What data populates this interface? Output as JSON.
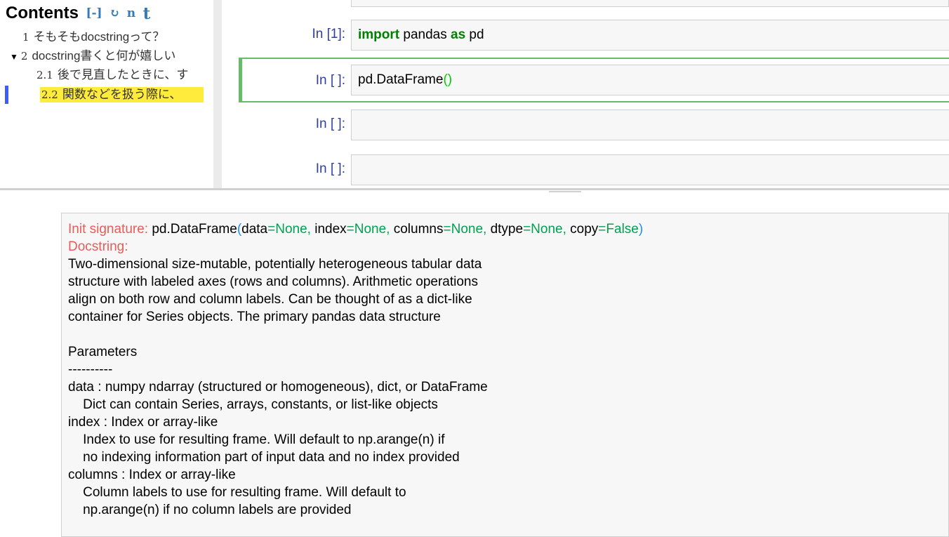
{
  "toc": {
    "title": "Contents",
    "collapse_label": "[-]",
    "refresh_icon": "↻",
    "n_label": "n",
    "t_label": "t",
    "items": [
      {
        "num": "1",
        "label": "そもそもdocstringって？"
      },
      {
        "num": "2",
        "label": "docstring書くと何が嬉しい"
      },
      {
        "num": "2.1",
        "label": "後で見直したときに、す"
      },
      {
        "num": "2.2",
        "label": "関数などを扱う際に、"
      }
    ]
  },
  "cells": [
    {
      "prompt": "In [1]:",
      "kw1": "import",
      "mid": " pandas ",
      "kw2": "as",
      "end": " pd"
    },
    {
      "prompt": "In [ ]:",
      "code": "pd.DataFrame",
      "paren": "()"
    },
    {
      "prompt": "In [ ]:",
      "code": ""
    },
    {
      "prompt": "In [ ]:",
      "code": ""
    }
  ],
  "pager": {
    "sig_label": "Init signature:",
    "sig_name": " pd.DataFrame",
    "sig_open": "(",
    "sig_args": [
      {
        "name": "data",
        "eq": "=",
        "val": "None,"
      },
      {
        "name": " index",
        "eq": "=",
        "val": "None,"
      },
      {
        "name": " columns",
        "eq": "=",
        "val": "None,"
      },
      {
        "name": " dtype",
        "eq": "=",
        "val": "None,"
      },
      {
        "name": " copy",
        "eq": "=",
        "val": "False"
      }
    ],
    "sig_close": ")",
    "doc_label": "Docstring:",
    "doc_body": "Two-dimensional size-mutable, potentially heterogeneous tabular data\nstructure with labeled axes (rows and columns). Arithmetic operations\nalign on both row and column labels. Can be thought of as a dict-like\ncontainer for Series objects. The primary pandas data structure\n\nParameters\n----------\ndata : numpy ndarray (structured or homogeneous), dict, or DataFrame\n    Dict can contain Series, arrays, constants, or list-like objects\nindex : Index or array-like\n    Index to use for resulting frame. Will default to np.arange(n) if\n    no indexing information part of input data and no index provided\ncolumns : Index or array-like\n    Column labels to use for resulting frame. Will default to\n    np.arange(n) if no column labels are provided"
  },
  "colors": {
    "accent": "#337ab7",
    "prompt": "#303f9f",
    "keyword": "#008000",
    "selected_border": "#66bb6a",
    "toc_highlight": "#ffeb3b",
    "doc_label": "#e75c58",
    "doc_equals": "#00a250",
    "doc_paren": "#208ffb"
  }
}
